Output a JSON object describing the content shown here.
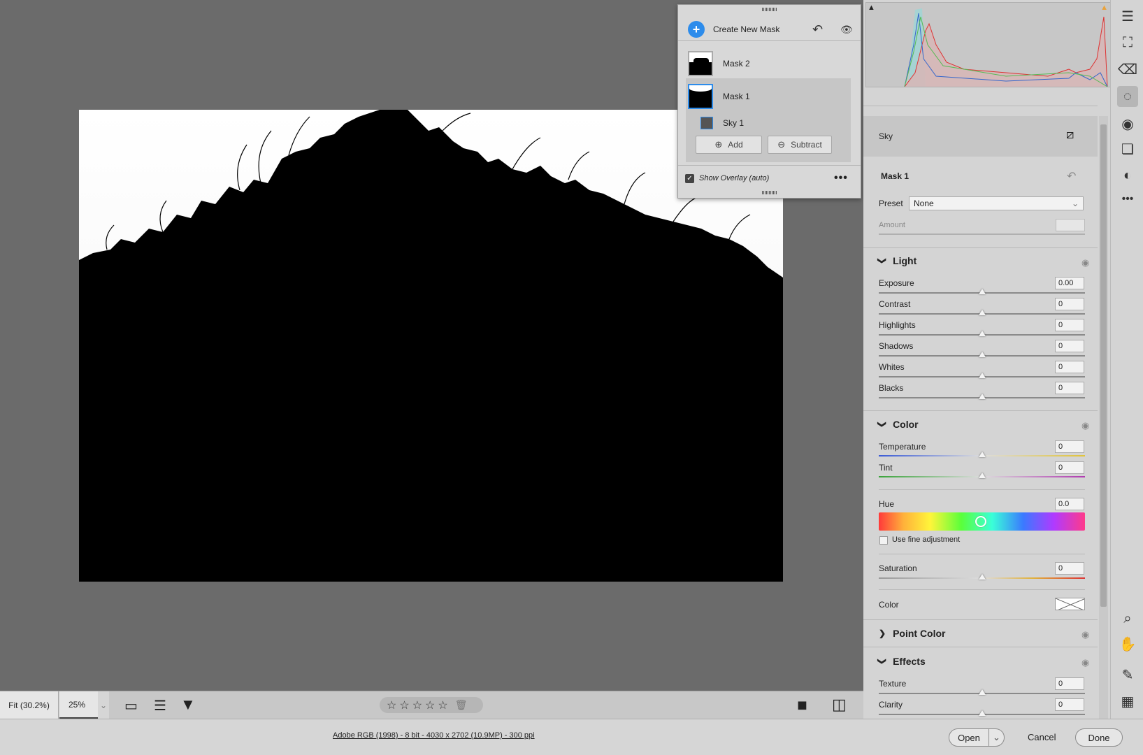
{
  "mask_panel": {
    "create_label": "Create New Mask",
    "masks": [
      {
        "name": "Mask 2"
      },
      {
        "name": "Mask 1"
      }
    ],
    "component": "Sky 1",
    "add_label": "Add",
    "subtract_label": "Subtract",
    "overlay_label": "Show Overlay (auto)",
    "overlay_checked": true
  },
  "properties": {
    "component_title": "Sky",
    "mask_title": "Mask 1",
    "preset_label": "Preset",
    "preset_value": "None",
    "amount_label": "Amount",
    "light": {
      "title": "Light",
      "sliders": [
        {
          "label": "Exposure",
          "value": "0.00"
        },
        {
          "label": "Contrast",
          "value": "0"
        },
        {
          "label": "Highlights",
          "value": "0"
        },
        {
          "label": "Shadows",
          "value": "0"
        },
        {
          "label": "Whites",
          "value": "0"
        },
        {
          "label": "Blacks",
          "value": "0"
        }
      ]
    },
    "color": {
      "title": "Color",
      "temperature_label": "Temperature",
      "temperature_value": "0",
      "tint_label": "Tint",
      "tint_value": "0",
      "hue_label": "Hue",
      "hue_value": "0.0",
      "fine_label": "Use fine adjustment",
      "saturation_label": "Saturation",
      "saturation_value": "0",
      "color_label": "Color"
    },
    "point_color": {
      "title": "Point Color"
    },
    "effects": {
      "title": "Effects",
      "texture_label": "Texture",
      "texture_value": "0",
      "clarity_label": "Clarity",
      "clarity_value": "0"
    }
  },
  "bottom_bar": {
    "fit_label": "Fit (30.2%)",
    "zoom_value": "25%",
    "stars": [
      "☆",
      "☆",
      "☆",
      "☆",
      "☆"
    ]
  },
  "status_bar": {
    "info": "Adobe RGB (1998) - 8 bit - 4030 x 2702 (10.9MP) - 300 ppi",
    "open_label": "Open",
    "cancel_label": "Cancel",
    "done_label": "Done"
  },
  "colors": {
    "accent": "#2d8ceb",
    "panel_bg": "#d4d4d4",
    "canvas_bg": "#6b6b6b"
  },
  "icons": [
    "plus-circle-icon",
    "undo-icon",
    "eye-icon",
    "edit-icon",
    "crop-icon",
    "eraser-icon",
    "mask-icon",
    "redeye-icon",
    "presets-icon",
    "blend-icon",
    "more-icon",
    "zoom-icon",
    "hand-icon",
    "eyedropper-icon",
    "grid-icon",
    "filter-icon",
    "sort-icon",
    "trash-icon"
  ]
}
